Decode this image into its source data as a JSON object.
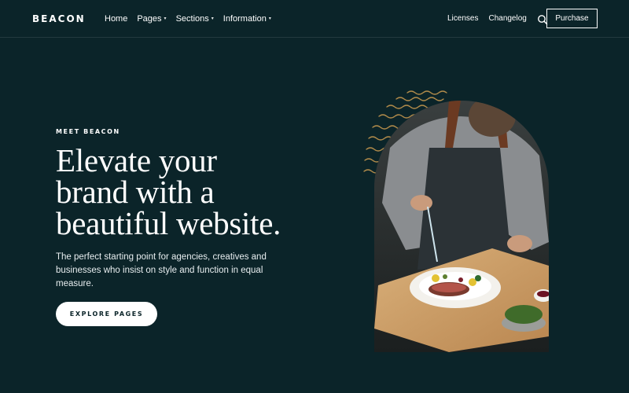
{
  "header": {
    "logo": "BEACON",
    "nav_left": [
      {
        "label": "Home",
        "dropdown": false
      },
      {
        "label": "Pages",
        "dropdown": true
      },
      {
        "label": "Sections",
        "dropdown": true
      },
      {
        "label": "Information",
        "dropdown": true
      }
    ],
    "nav_right": [
      {
        "label": "Licenses"
      },
      {
        "label": "Changelog"
      }
    ],
    "search_icon": "search-icon",
    "purchase_label": "Purchase"
  },
  "hero": {
    "eyebrow": "MEET BEACON",
    "headline_lines": [
      "Elevate your",
      "brand with a",
      "beautiful website."
    ],
    "subtext": "The perfect starting point for agencies, creatives and businesses who insist on style and function in equal measure.",
    "cta_label": "EXPLORE PAGES"
  },
  "colors": {
    "background": "#0b2429",
    "text": "#ffffff",
    "accent_wave": "#b08a4a"
  }
}
